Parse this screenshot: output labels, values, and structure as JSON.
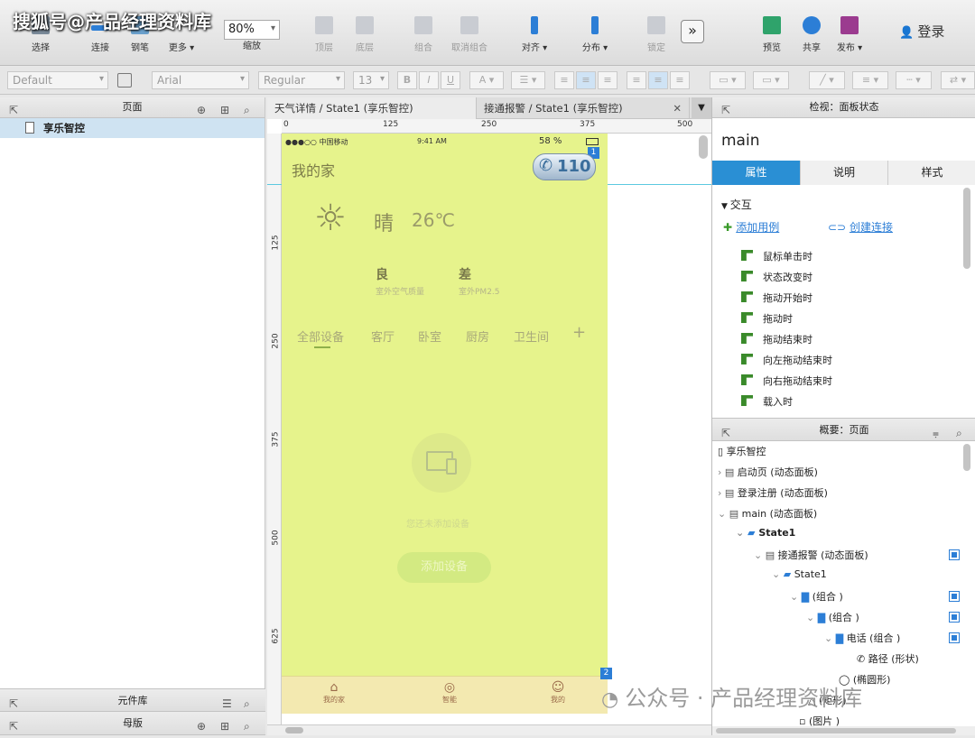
{
  "watermark_top": "搜狐号@产品经理资料库",
  "watermark_bottom": "公众号 · 产品经理资料库",
  "toolbar": {
    "select": "选择",
    "connect": "连接",
    "pen": "钢笔",
    "more": "更多 ▾",
    "zoom_value": "80%",
    "zoom_label": "缩放",
    "top_layer": "顶层",
    "bottom_layer": "底层",
    "group": "组合",
    "ungroup": "取消组合",
    "align": "对齐 ▾",
    "distribute": "分布 ▾",
    "lock": "锁定",
    "preview": "预览",
    "share": "共享",
    "publish": "发布 ▾",
    "login": "登录"
  },
  "format": {
    "style": "Default",
    "font": "Arial",
    "weight": "Regular",
    "size": "13"
  },
  "pages_panel": {
    "title": "页面",
    "page": "享乐智控"
  },
  "widgets_panel": {
    "title": "元件库"
  },
  "masters_panel": {
    "title": "母版"
  },
  "tabs": [
    "天气详情 / State1 (享乐智控)",
    "接通报警 / State1 (享乐智控)"
  ],
  "rulers": {
    "h": [
      "0",
      "125",
      "250",
      "375",
      "500"
    ],
    "v": [
      "125",
      "250",
      "375",
      "500",
      "625"
    ]
  },
  "phone": {
    "carrier": "●●●○○ 中国移动",
    "time": "9:41 AM",
    "battery": "58 %",
    "title": "我的家",
    "call": "110",
    "weather": "晴",
    "temp": "26℃",
    "air_val": "良",
    "air_label": "室外空气质量",
    "pm_val": "差",
    "pm_label": "室外PM2.5",
    "rooms": [
      "全部设备",
      "客厅",
      "卧室",
      "厨房",
      "卫生间"
    ],
    "plus": "+",
    "empty_text": "您还未添加设备",
    "add_btn": "添加设备",
    "nav": [
      "我的家",
      "智能",
      "我的"
    ],
    "badge1": "1",
    "badge2": "2"
  },
  "inspector": {
    "title": "检视：面板状态",
    "name": "main",
    "tabs": [
      "属性",
      "说明",
      "样式"
    ],
    "section": "交互",
    "add_case": "添加用例",
    "create_link": "创建连接",
    "events": [
      "鼠标单击时",
      "状态改变时",
      "拖动开始时",
      "拖动时",
      "拖动结束时",
      "向左拖动结束时",
      "向右拖动结束时",
      "载入时"
    ]
  },
  "outline": {
    "title": "概要：页面",
    "items": [
      "享乐智控",
      "启动页 (动态面板)",
      "登录注册 (动态面板)",
      "main (动态面板)",
      "State1",
      "接通报警 (动态面板)",
      "State1",
      "(组合 )",
      "(组合 )",
      "电话 (组合 )",
      "路径 (形状)",
      "(椭圆形)",
      "(矩形)",
      "(图片 )"
    ]
  },
  "colors": {
    "phone_bg": "#e6f38c",
    "accent": "#2c7ed6",
    "active_tab": "#2a8fd4"
  }
}
